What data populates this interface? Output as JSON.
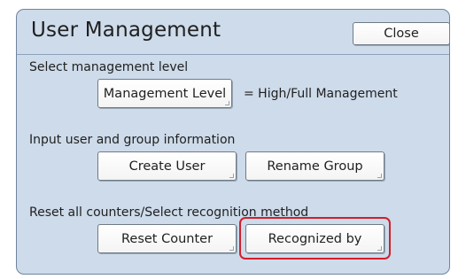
{
  "window": {
    "title": "User Management",
    "close_label": "Close"
  },
  "level_section": {
    "label": "Select management level",
    "button_label": "Management Level",
    "value_text": "= High/Full Management"
  },
  "user_section": {
    "label": "Input user and group information",
    "create_user_label": "Create User",
    "rename_group_label": "Rename Group"
  },
  "counter_section": {
    "label": "Reset all counters/Select recognition method",
    "reset_counter_label": "Reset Counter",
    "recognized_by_label": "Recognized by"
  },
  "colors": {
    "panel_bg": "#cddbea",
    "highlight": "#d21f2b"
  }
}
